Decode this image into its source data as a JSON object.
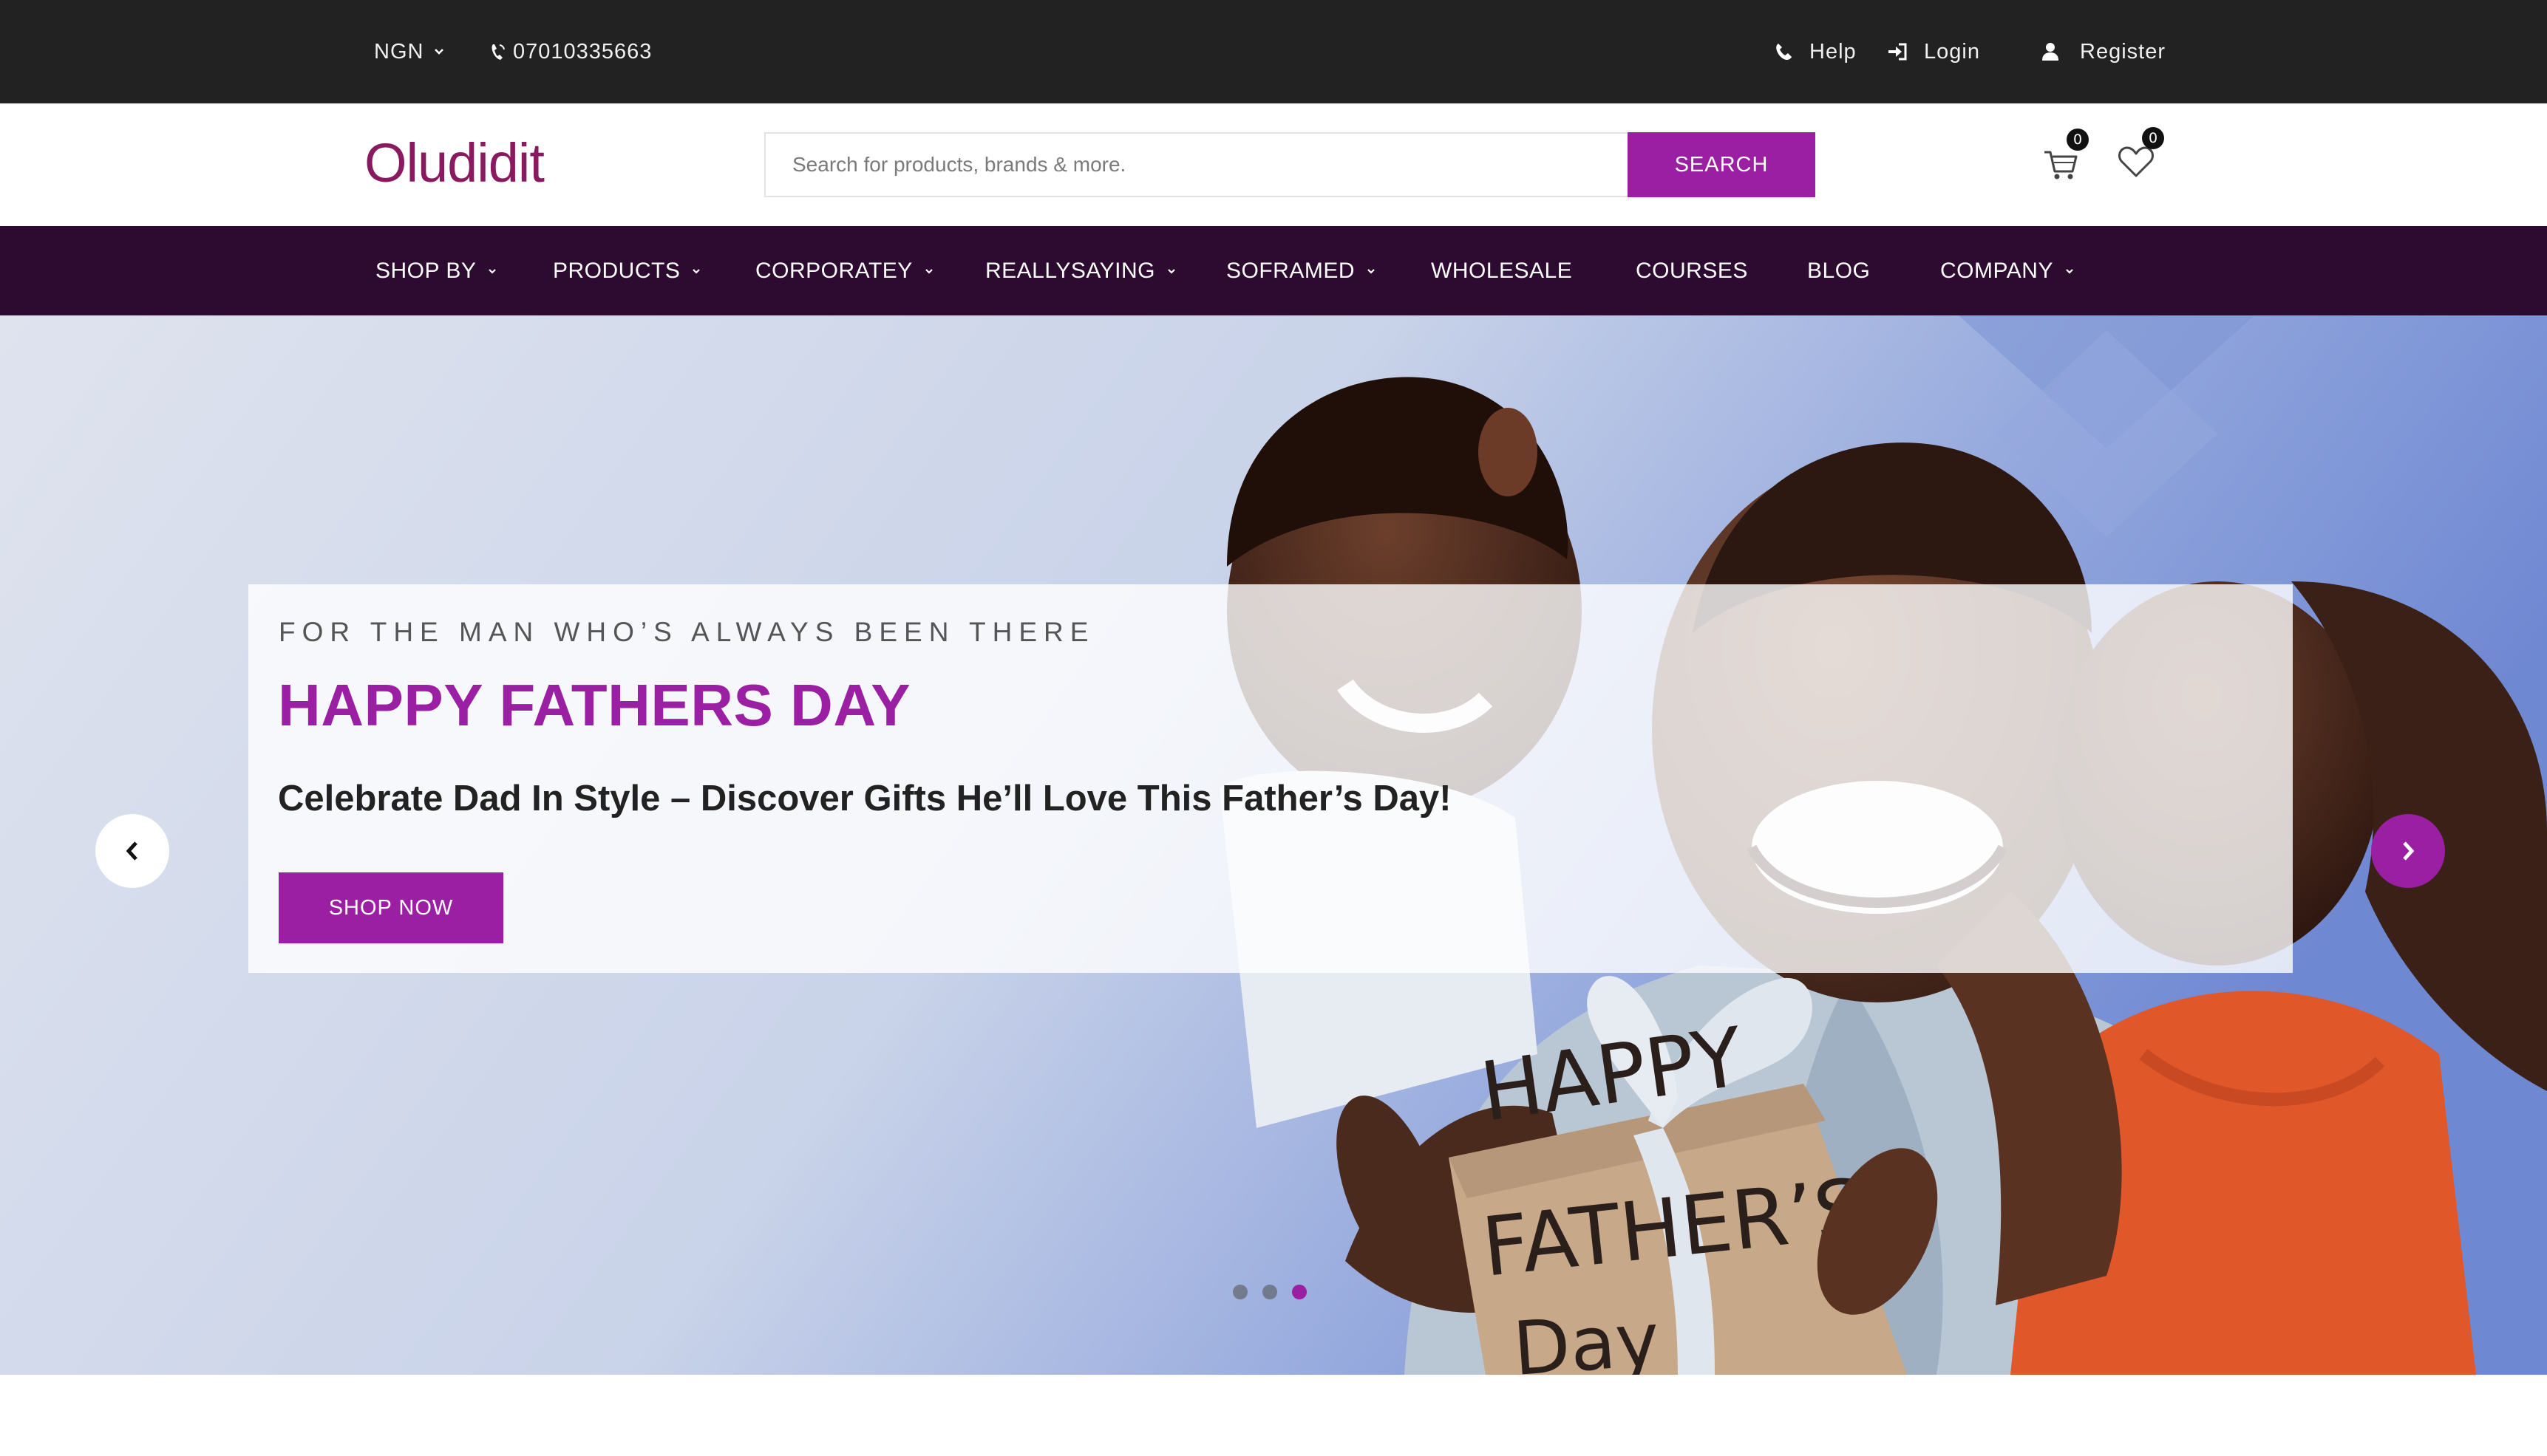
{
  "topbar": {
    "currency": "NGN",
    "phone": "07010335663",
    "help": "Help",
    "login": "Login",
    "register": "Register"
  },
  "header": {
    "logo_text": "Oludidit",
    "search_placeholder": "Search for products, brands & more.",
    "search_button": "SEARCH",
    "cart_count": "0",
    "wishlist_count": "0"
  },
  "nav": {
    "items": [
      {
        "label": "SHOP BY",
        "has_dropdown": true
      },
      {
        "label": "PRODUCTS",
        "has_dropdown": true
      },
      {
        "label": "CORPORATEY",
        "has_dropdown": true
      },
      {
        "label": "REALLYSAYING",
        "has_dropdown": true
      },
      {
        "label": "SOFRAMED",
        "has_dropdown": true
      },
      {
        "label": "WHOLESALE",
        "has_dropdown": false
      },
      {
        "label": "COURSES",
        "has_dropdown": false
      },
      {
        "label": "BLOG",
        "has_dropdown": false
      },
      {
        "label": "COMPANY",
        "has_dropdown": true
      }
    ]
  },
  "hero": {
    "eyebrow": "FOR THE MAN WHO’S ALWAYS BEEN THERE",
    "title": "HAPPY FATHERS DAY",
    "subtitle": "Celebrate Dad In Style – Discover Gifts He’ll Love This Father’s Day!",
    "cta": "SHOP NOW",
    "gift_text": [
      "HAPPY",
      "FATHER’S",
      "Day"
    ],
    "slides_total": 3,
    "active_slide": 3
  },
  "colors": {
    "accent": "#9a1fa3",
    "topbar_bg": "#222222",
    "nav_bg": "#2d0a2f"
  },
  "icons": {
    "phone": "phone-icon",
    "help": "phone-icon",
    "login": "sign-in-icon",
    "register": "user-icon",
    "cart": "cart-icon",
    "wishlist": "heart-icon",
    "prev": "chevron-left-icon",
    "next": "chevron-right-icon"
  }
}
